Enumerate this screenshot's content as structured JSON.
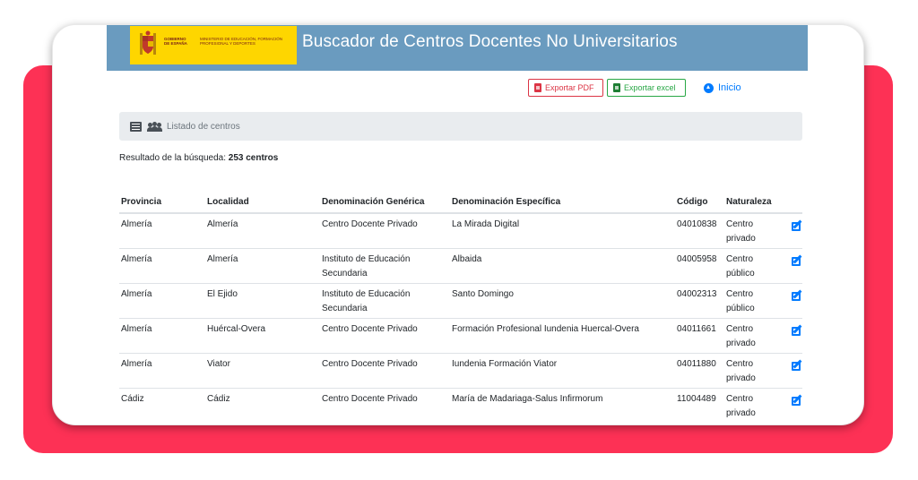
{
  "header": {
    "title": "Buscador de Centros Docentes No Universitarios",
    "logo_left_text": "GOBIERNO DE ESPAÑA",
    "logo_right_text": "MINISTERIO DE EDUCACIÓN, FORMACIÓN PROFESIONAL Y DEPORTES"
  },
  "toolbar": {
    "pdf_label": "Exportar PDF",
    "excel_label": "Exportar excel",
    "home_label": "Inicio"
  },
  "section": {
    "label": "Listado de centros"
  },
  "result": {
    "prefix": "Resultado de la búsqueda: ",
    "count": "253 centros"
  },
  "table": {
    "headers": [
      "Provincia",
      "Localidad",
      "Denominación Genérica",
      "Denominación Específica",
      "Código",
      "Naturaleza"
    ],
    "rows": [
      [
        "Almería",
        "Almería",
        "Centro Docente Privado",
        "La Mirada Digital",
        "04010838",
        "Centro privado"
      ],
      [
        "Almería",
        "Almería",
        "Instituto de Educación Secundaria",
        "Albaida",
        "04005958",
        "Centro público"
      ],
      [
        "Almería",
        "El Ejido",
        "Instituto de Educación Secundaria",
        "Santo Domingo",
        "04002313",
        "Centro público"
      ],
      [
        "Almería",
        "Huércal-Overa",
        "Centro Docente Privado",
        "Formación Profesional Iundenia Huercal-Overa",
        "04011661",
        "Centro privado"
      ],
      [
        "Almería",
        "Viator",
        "Centro Docente Privado",
        "Iundenia Formación Viator",
        "04011880",
        "Centro privado"
      ],
      [
        "Cádiz",
        "Cádiz",
        "Centro Docente Privado",
        "María de Madariaga-Salus Infirmorum",
        "11004489",
        "Centro privado"
      ]
    ]
  },
  "colors": {
    "accent": "#fd3155",
    "header_bar": "#6a9bbf",
    "logo_yellow": "#fed600",
    "link": "#007bff",
    "pdf": "#dc3545",
    "excel": "#28a745"
  },
  "icons": {
    "pdf": "pdf-file-icon",
    "excel": "excel-file-icon",
    "home": "home-icon",
    "list": "list-icon",
    "users": "users-icon",
    "edit": "edit-icon"
  }
}
